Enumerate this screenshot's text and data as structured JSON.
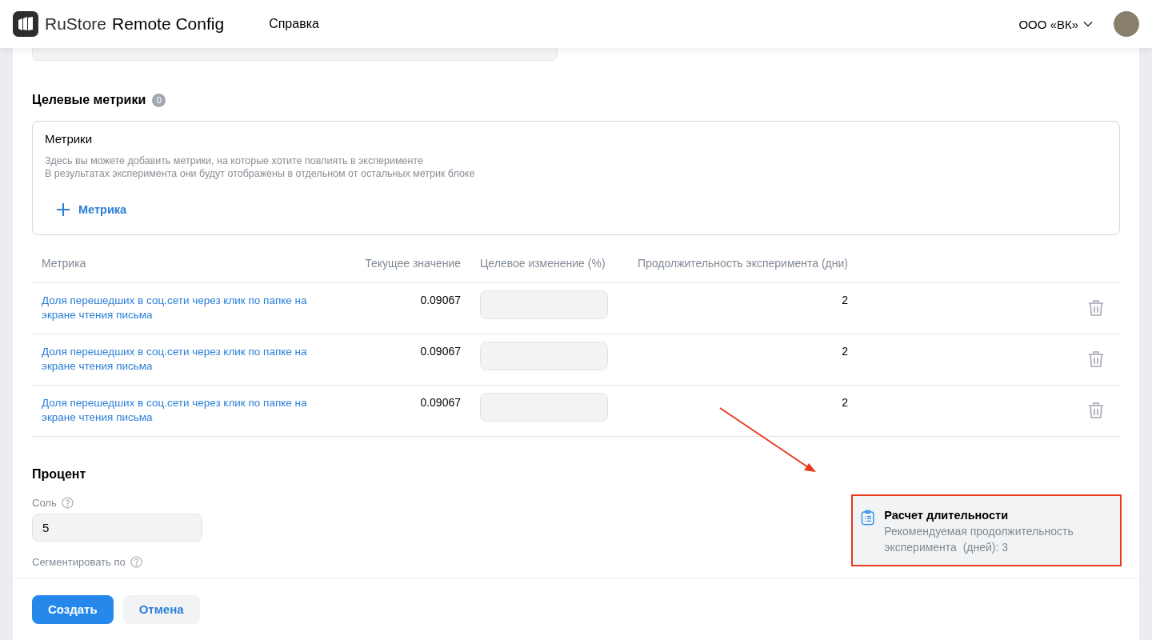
{
  "header": {
    "brand": "RuStore",
    "product": "Remote Config",
    "nav": [
      {
        "label": "Справка"
      }
    ],
    "org": "ООО «ВК»"
  },
  "target_metrics": {
    "title": "Целевые метрики",
    "count": "0",
    "metrics_box": {
      "title": "Метрики",
      "description": [
        "Здесь вы можете добавить метрики, на которые хотите повлиять в эксперименте",
        "В результатах эксперимента они будут отображены в отдельном от остальных метрик блоке"
      ],
      "add_button": "Метрика"
    }
  },
  "table": {
    "columns": [
      "Метрика",
      "Текущее значение",
      "Целевое изменение (%)",
      "Продолжительность эксперимента (дни)"
    ],
    "rows": [
      {
        "metric": "Доля перешедших в соц.сети через клик по папке на экране чтения письма",
        "current": "0.09067",
        "duration": "2"
      },
      {
        "metric": "Доля перешедших в соц.сети через клик по папке на экране чтения письма",
        "current": "0.09067",
        "duration": "2"
      },
      {
        "metric": "Доля перешедших в соц.сети через клик по папке на экране чтения письма",
        "current": "0.09067",
        "duration": "2"
      }
    ]
  },
  "percent": {
    "title": "Процент",
    "fields": [
      {
        "kind": "input",
        "label": "Соль",
        "value": "5"
      },
      {
        "kind": "label",
        "label": "Сегментировать по"
      }
    ]
  },
  "footer": {
    "buttons": [
      {
        "label": "Создать",
        "kind": "primary"
      },
      {
        "label": "Отмена",
        "kind": "secondary"
      }
    ]
  },
  "toast": {
    "title": "Расчет длительности",
    "text": "Рекомендуемая продолжительность эксперимента  (дней): 3"
  }
}
